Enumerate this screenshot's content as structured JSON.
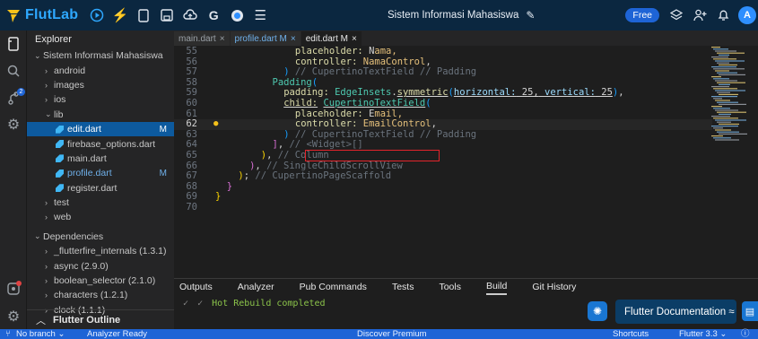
{
  "app": {
    "name": "FlutLab",
    "project_title": "Sistem Informasi Mahasiswa",
    "plan_badge": "Free",
    "avatar_letter": "A"
  },
  "explorer": {
    "title": "Explorer",
    "items": [
      {
        "label": "Sistem Informasi Mahasiswa",
        "chev": "⌄",
        "indent": 0,
        "kind": "folder"
      },
      {
        "label": "android",
        "chev": "›",
        "indent": 1,
        "kind": "folder"
      },
      {
        "label": "images",
        "chev": "›",
        "indent": 1,
        "kind": "folder"
      },
      {
        "label": "ios",
        "chev": "›",
        "indent": 1,
        "kind": "folder"
      },
      {
        "label": "lib",
        "chev": "⌄",
        "indent": 1,
        "kind": "folder"
      },
      {
        "label": "edit.dart",
        "indent": 2,
        "kind": "file",
        "selected": true,
        "mod": "M"
      },
      {
        "label": "firebase_options.dart",
        "indent": 2,
        "kind": "file"
      },
      {
        "label": "main.dart",
        "indent": 2,
        "kind": "file"
      },
      {
        "label": "profile.dart",
        "indent": 2,
        "kind": "file",
        "mod": "M"
      },
      {
        "label": "register.dart",
        "indent": 2,
        "kind": "file"
      },
      {
        "label": "test",
        "chev": "›",
        "indent": 1,
        "kind": "folder"
      },
      {
        "label": "web",
        "chev": "›",
        "indent": 1,
        "kind": "folder"
      }
    ],
    "dependencies_title": "Dependencies",
    "dependencies": [
      "_flutterfire_internals (1.3.1)",
      "async (2.9.0)",
      "boolean_selector (2.1.0)",
      "characters (1.2.1)",
      "clock (1.1.1)"
    ],
    "outline_label": "Flutter Outline"
  },
  "tabs": [
    {
      "label": "main.dart",
      "close": "×"
    },
    {
      "label": "profile.dart M",
      "close": "×",
      "modified": true
    },
    {
      "label": "edit.dart M",
      "close": "×",
      "active": true
    }
  ],
  "code": [
    {
      "ln": "55",
      "text": "placeholder: Nama,"
    },
    {
      "ln": "56",
      "text": "controller: NamaControl,"
    },
    {
      "ln": "57",
      "text": ")",
      "comment": "// CupertinoTextField // Padding"
    },
    {
      "ln": "58",
      "text": "Padding("
    },
    {
      "ln": "59",
      "text": "padding: EdgeInsets.symmetric(horizontal: 25, vertical: 25),"
    },
    {
      "ln": "60",
      "text": "child: CupertinoTextField("
    },
    {
      "ln": "61",
      "text": "placeholder: Email,"
    },
    {
      "ln": "62",
      "text": "controller: EmailControl,"
    },
    {
      "ln": "63",
      "text": ")",
      "comment": "// CupertinoTextField // Padding"
    },
    {
      "ln": "64",
      "text": "],",
      "comment": "// <Widget>[]"
    },
    {
      "ln": "65",
      "text": "),",
      "comment": "// Column"
    },
    {
      "ln": "66",
      "text": "),",
      "comment": "// SingleChildScrollView"
    },
    {
      "ln": "67",
      "text": ");",
      "comment": "// CupertinoPageScaffold"
    },
    {
      "ln": "68",
      "text": "}"
    },
    {
      "ln": "69",
      "text": "}"
    },
    {
      "ln": "70",
      "text": ""
    }
  ],
  "panel": {
    "tabs": [
      "Outputs",
      "Analyzer",
      "Pub Commands",
      "Tests",
      "Tools",
      "Build",
      "Git History"
    ],
    "active_tab": "Build",
    "output_line": "Hot Rebuild completed",
    "docs_button": "Flutter Documentation ≈"
  },
  "statusbar": {
    "branch": "No branch ⌄",
    "analyzer": "Analyzer Ready",
    "promo": "Discover Premium",
    "shortcuts": "Shortcuts",
    "version": "Flutter 3.3 ⌄"
  },
  "colors": {
    "accent": "#1e64d6",
    "topbar": "#0b2740",
    "highlight_box": "#e3242b"
  }
}
